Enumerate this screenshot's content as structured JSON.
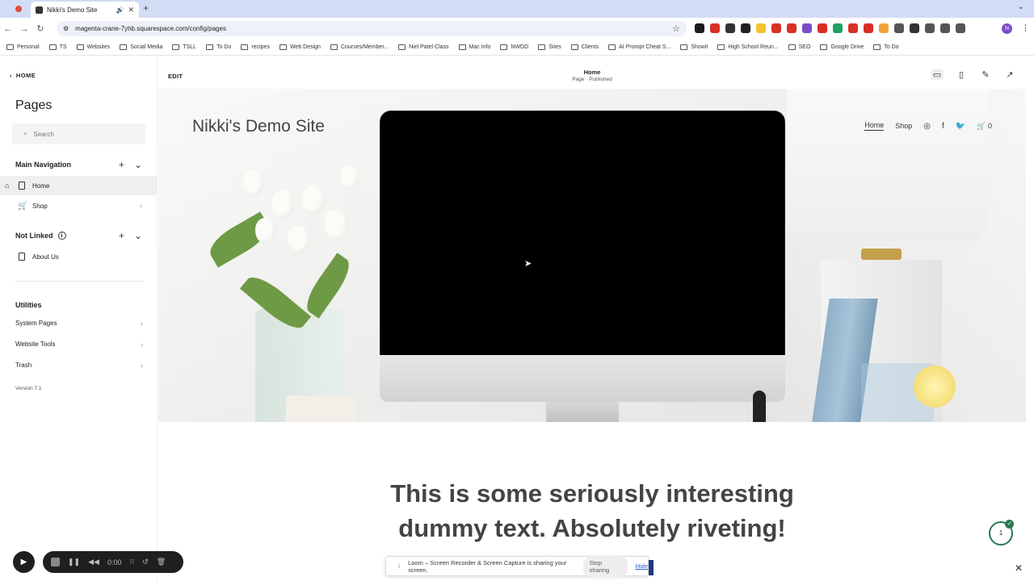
{
  "browser": {
    "tab_title": "Nikki's Demo Site",
    "url": "magenta-crane-7yhb.squarespace.com/config/pages",
    "extension_colors": [
      "#1c1c1c",
      "#d93025",
      "#333333",
      "#222222",
      "#f7c12f",
      "#d93025",
      "#d93025",
      "#7b4cc9",
      "#d93025",
      "#1da462",
      "#d93025",
      "#d93025",
      "#f4a13a",
      "#555555",
      "#333333",
      "#555555",
      "#555555",
      "#555555"
    ],
    "profile_initial": "N",
    "bookmarks": [
      {
        "label": "Personal"
      },
      {
        "label": "TS"
      },
      {
        "label": "Websites"
      },
      {
        "label": "Social Media"
      },
      {
        "label": "TSLL"
      },
      {
        "label": "To Do"
      },
      {
        "label": "recipes"
      },
      {
        "label": "Web Design"
      },
      {
        "label": "Courses/Member..."
      },
      {
        "label": "Niel Patel Class"
      },
      {
        "label": "Mac Info"
      },
      {
        "label": "NWDD"
      },
      {
        "label": "Sites"
      },
      {
        "label": "Clients"
      },
      {
        "label": "AI Prompt Cheat S..."
      },
      {
        "label": "Showit"
      },
      {
        "label": "High School Reun..."
      },
      {
        "label": "SEO"
      },
      {
        "label": "Google Drive"
      },
      {
        "label": "To Do"
      }
    ]
  },
  "sidebar": {
    "back_label": "HOME",
    "title": "Pages",
    "search_placeholder": "Search",
    "main_nav_label": "Main Navigation",
    "main_nav_items": [
      {
        "label": "Home",
        "active": true
      },
      {
        "label": "Shop",
        "active": false
      }
    ],
    "not_linked_label": "Not Linked",
    "not_linked_items": [
      {
        "label": "About Us"
      }
    ],
    "utilities_label": "Utilities",
    "utilities_items": [
      {
        "label": "System Pages"
      },
      {
        "label": "Website Tools"
      },
      {
        "label": "Trash"
      }
    ],
    "version": "Version 7.1"
  },
  "editor": {
    "edit_label": "EDIT",
    "page_name": "Home",
    "page_status": "Page · Published"
  },
  "site": {
    "title": "Nikki's Demo Site",
    "nav": [
      {
        "label": "Home"
      },
      {
        "label": "Shop"
      }
    ],
    "cart_count": "0",
    "headline_line1": "This is some seriously interesting",
    "headline_line2": "dummy text.  Absolutely riveting!",
    "badge_count": "1"
  },
  "loom": {
    "timer": "0:00",
    "share_message": "Loom – Screen Recorder & Screen Capture is sharing your screen.",
    "stop_label": "Stop sharing",
    "hide_label": "Hide"
  }
}
